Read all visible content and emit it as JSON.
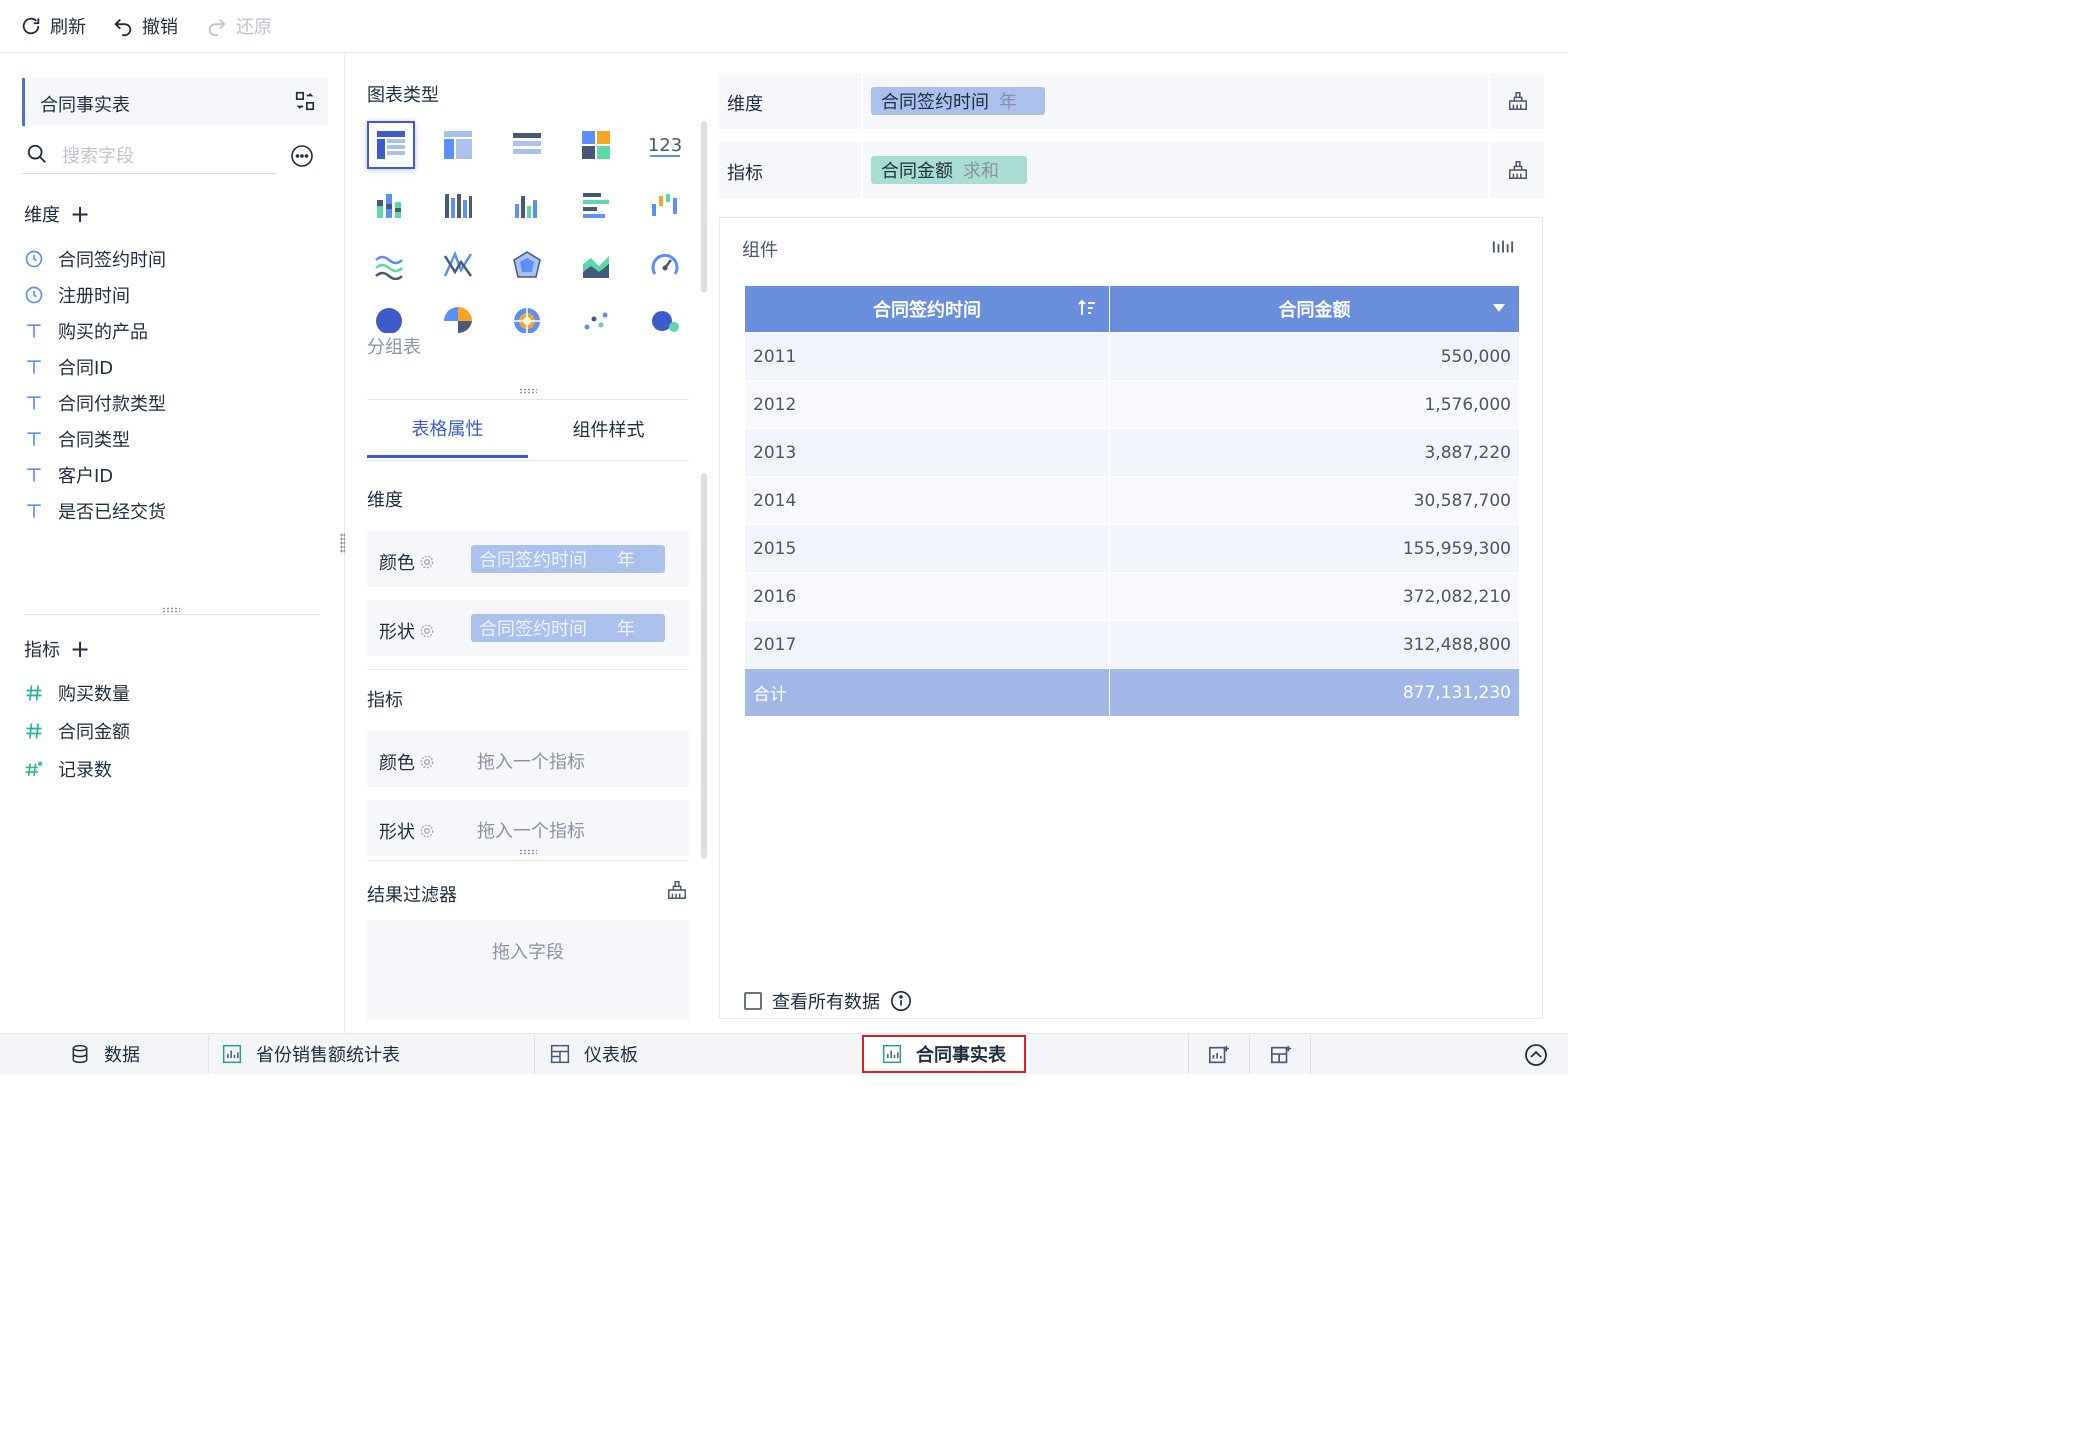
{
  "toolbar": {
    "refresh": "刷新",
    "undo": "撤销",
    "redo": "还原"
  },
  "left": {
    "dataset": "合同事实表",
    "search_placeholder": "搜索字段",
    "dimension_title": "维度",
    "dimensions": [
      "合同签约时间",
      "注册时间",
      "购买的产品",
      "合同ID",
      "合同付款类型",
      "合同类型",
      "客户ID",
      "是否已经交货"
    ],
    "dimension_icons": [
      "clock-icon",
      "clock-icon",
      "text-icon",
      "text-icon",
      "text-icon",
      "text-icon",
      "text-icon",
      "text-icon"
    ],
    "measure_title": "指标",
    "measures": [
      "购买数量",
      "合同金额",
      "记录数"
    ],
    "measure_icons": [
      "number-icon",
      "number-icon",
      "count-icon"
    ]
  },
  "middle": {
    "chart_type_title": "图表类型",
    "group_table_label": "分组表",
    "tabs": [
      "表格属性",
      "组件样式"
    ],
    "dimension_title": "维度",
    "color_label": "颜色",
    "shape_label": "形状",
    "dim_chip_field": "合同签约时间",
    "dim_chip_sub": "年",
    "measure_title": "指标",
    "measure_placeholder": "拖入一个指标",
    "filter_title": "结果过滤器",
    "filter_placeholder": "拖入字段"
  },
  "shelves": {
    "dimension_label": "维度",
    "dimension_field": "合同签约时间",
    "dimension_sub": "年",
    "measure_label": "指标",
    "measure_field": "合同金额",
    "measure_sub": "求和",
    "dimension_pill_color": "#a9c1ec",
    "measure_pill_color": "#a8ddd3"
  },
  "component": {
    "title": "组件",
    "headers": [
      "合同签约时间",
      "合同金额"
    ],
    "rows": [
      [
        "2011",
        "550,000"
      ],
      [
        "2012",
        "1,576,000"
      ],
      [
        "2013",
        "3,887,220"
      ],
      [
        "2014",
        "30,587,700"
      ],
      [
        "2015",
        "155,959,300"
      ],
      [
        "2016",
        "372,082,210"
      ],
      [
        "2017",
        "312,488,800"
      ]
    ],
    "total": [
      "合计",
      "877,131,230"
    ],
    "view_all": "查看所有数据"
  },
  "bottom": {
    "tabs": [
      "数据",
      "省份销售额统计表",
      "仪表板",
      "合同事实表"
    ],
    "active": "合同事实表"
  },
  "colors": {
    "accent": "#3d5cc9",
    "header": "#6a8fdc",
    "total": "#a2b8e8",
    "highlight": "#e02020"
  }
}
